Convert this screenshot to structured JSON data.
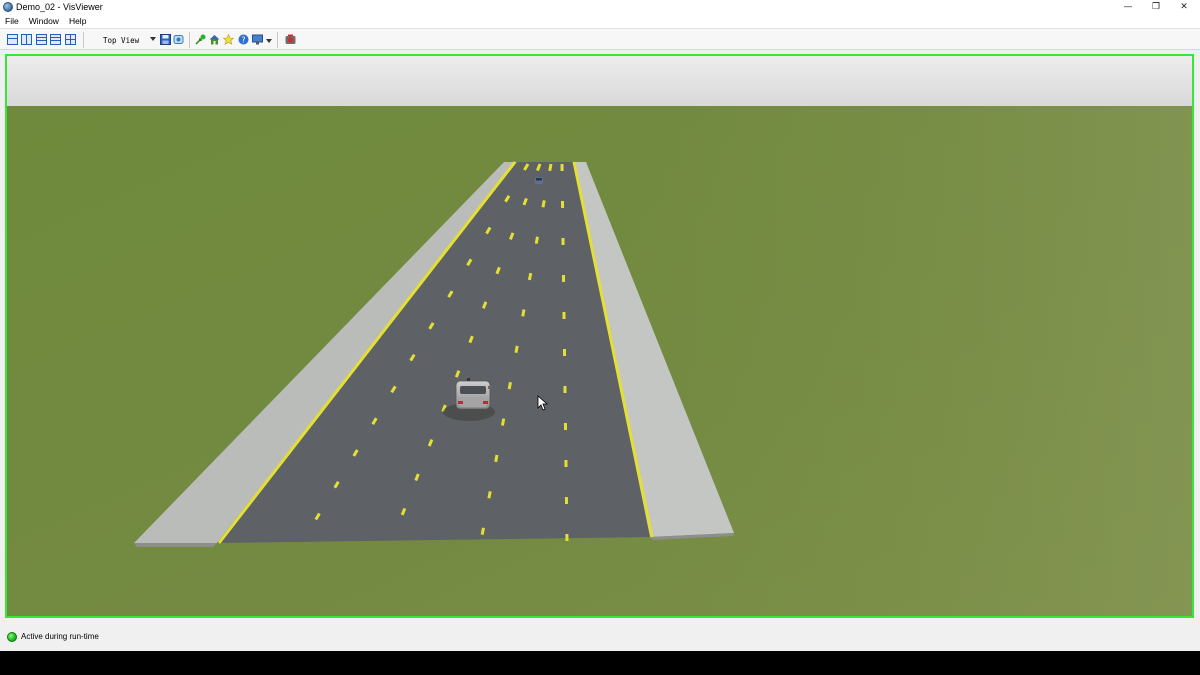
{
  "window": {
    "title": "Demo_02 - VisViewer",
    "controls": {
      "minimize": "—",
      "maximize": "❐",
      "close": "✕"
    }
  },
  "menu": {
    "items": [
      {
        "label": "File"
      },
      {
        "label": "Window"
      },
      {
        "label": "Help"
      }
    ]
  },
  "toolbar": {
    "view_select": {
      "value": "Top View"
    },
    "icons": [
      "single-view-layout-icon",
      "dual-view-layout-icon",
      "stacked-view-layout-icon",
      "quad-view-layout-icon",
      "save-icon",
      "record-icon",
      "navigate-icon",
      "home-icon",
      "star-icon",
      "help-icon",
      "display-icon",
      "stop-record-icon"
    ]
  },
  "viewport": {
    "accent_border": "#35e835",
    "sky_color": "#e4e4e4",
    "ground_color": "#72883f",
    "road_color": "#5d6066",
    "lane_marking_color": "#e8e23a"
  },
  "status": {
    "text": "Active during run-time",
    "indicator_color": "#1ec91e"
  }
}
